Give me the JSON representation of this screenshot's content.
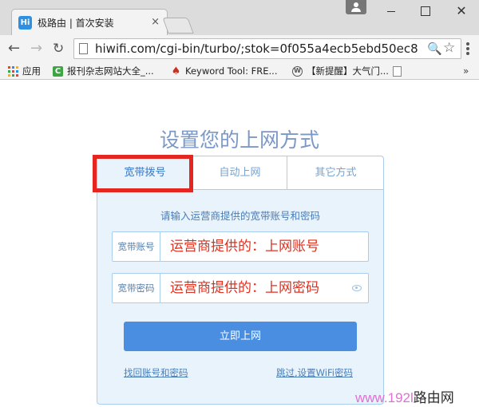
{
  "browser": {
    "tab": {
      "favicon_text": "Hi",
      "title": "极路由 | 首次安装",
      "close_glyph": "×"
    },
    "window_controls": {
      "close_glyph": "✕"
    },
    "nav": {
      "back_glyph": "←",
      "forward_glyph": "→",
      "reload_glyph": "↻"
    },
    "address": {
      "url": "hiwifi.com/cgi-bin/turbo/;stok=0f055a4ecb5ebd50ec8",
      "zoom_glyph": "🔍",
      "star_glyph": "☆"
    },
    "bookmarks": [
      {
        "label": "应用",
        "icon": "apps-icon"
      },
      {
        "label": "报刊杂志网站大全_...",
        "icon": "c-icon",
        "icon_text": "C"
      },
      {
        "label": "Keyword Tool: FRE...",
        "icon": "flame-icon",
        "icon_text": "♠"
      },
      {
        "label": "【新提醒】大气门...",
        "icon": "wordpress-icon",
        "icon_text": "W"
      },
      {
        "label": "",
        "icon": "page-icon"
      }
    ],
    "bookmarks_more": "»"
  },
  "page": {
    "heading": "设置您的上网方式",
    "tabs": [
      {
        "label": "宽带拨号",
        "active": true
      },
      {
        "label": "自动上网",
        "active": false
      },
      {
        "label": "其它方式",
        "active": false
      }
    ],
    "instruction": "请输入运营商提供的宽带账号和密码",
    "fields": {
      "username": {
        "label": "宽带账号",
        "value": "运营商提供的：上网账号"
      },
      "password": {
        "label": "宽带密码",
        "value": "运营商提供的：上网密码"
      }
    },
    "submit_label": "立即上网",
    "links": {
      "recover": "找回账号和密码",
      "skip": "跳过,设置WiFi密码"
    }
  },
  "watermark": {
    "text": "www.192l",
    "tail": "路由网"
  },
  "colors": {
    "accent": "#4a8ee2",
    "highlight": "#e52620",
    "annotation": "#e0301e",
    "panel_bg": "#e8f3fc"
  }
}
